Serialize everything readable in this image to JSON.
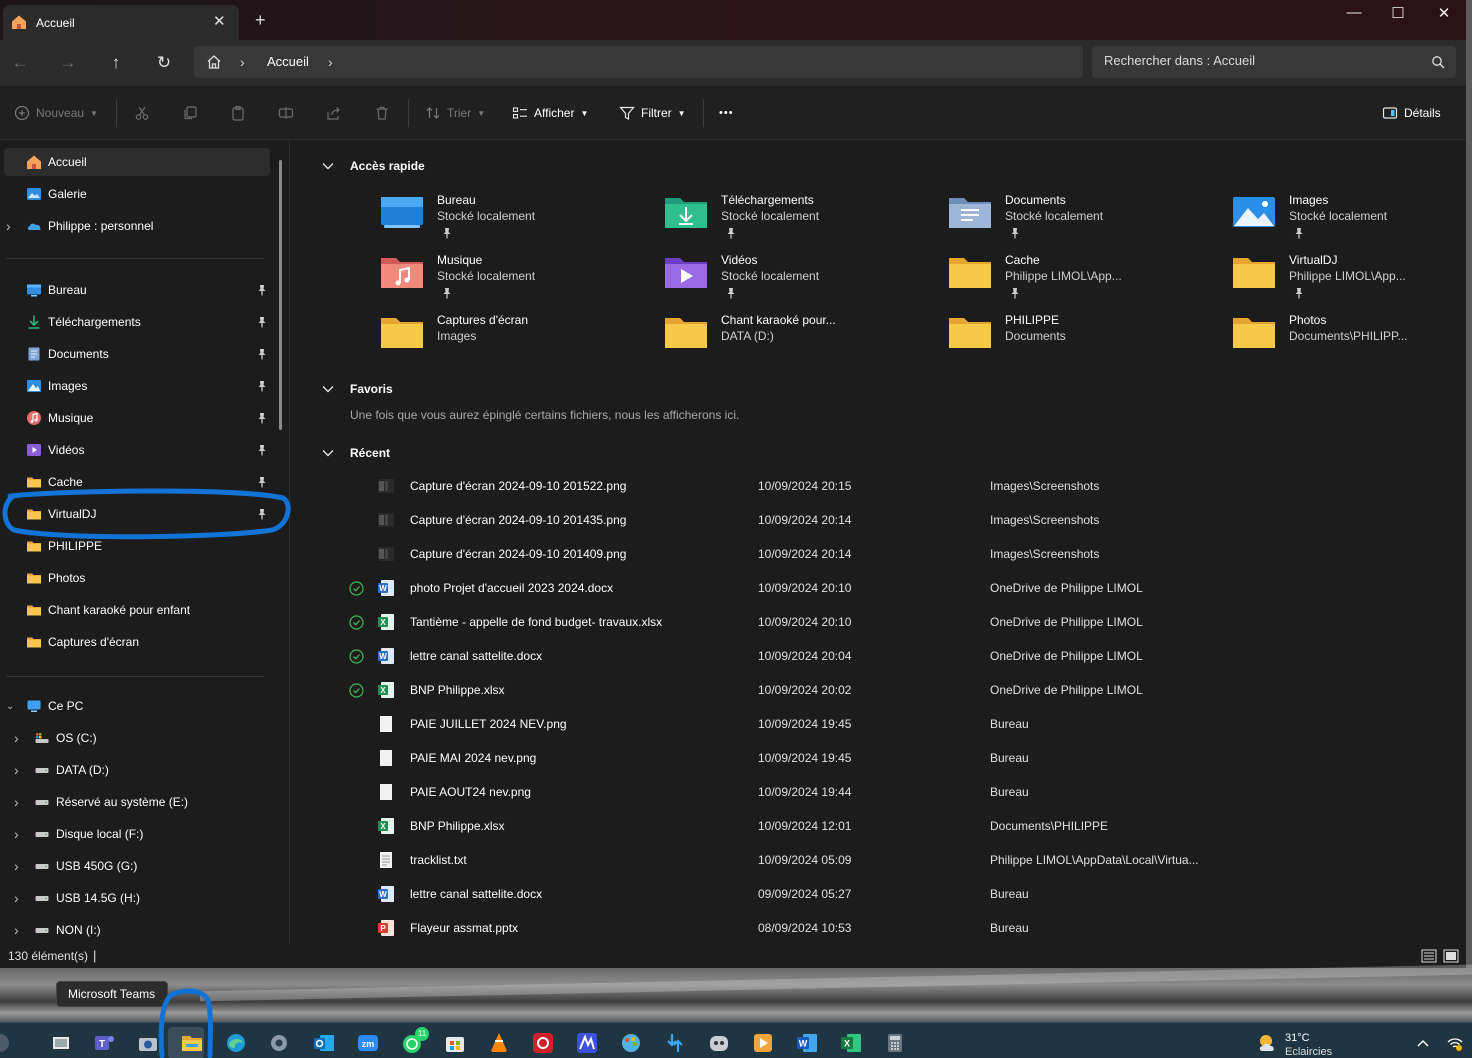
{
  "window": {
    "tab_title": "Accueil",
    "new_tab": "+",
    "controls": {
      "minimize": "—",
      "maximize": "☐",
      "close": "✕"
    }
  },
  "address": {
    "breadcrumb_current": "Accueil",
    "search_placeholder": "Rechercher dans : Accueil"
  },
  "toolbar": {
    "new_label": "Nouveau",
    "sort_label": "Trier",
    "view_label": "Afficher",
    "filter_label": "Filtrer",
    "more_label": "•••",
    "details_label": "Détails"
  },
  "sidebar": {
    "top": [
      {
        "label": "Accueil",
        "icon": "home-icon",
        "selected": true
      },
      {
        "label": "Galerie",
        "icon": "gallery-icon"
      },
      {
        "label": "Philippe : personnel",
        "icon": "onedrive-icon",
        "expandable": true
      }
    ],
    "pinned": [
      {
        "label": "Bureau",
        "icon": "desktop-folder-icon"
      },
      {
        "label": "Téléchargements",
        "icon": "download-icon"
      },
      {
        "label": "Documents",
        "icon": "documents-icon"
      },
      {
        "label": "Images",
        "icon": "pictures-icon"
      },
      {
        "label": "Musique",
        "icon": "music-icon"
      },
      {
        "label": "Vidéos",
        "icon": "videos-icon"
      },
      {
        "label": "Cache",
        "icon": "folder-icon"
      },
      {
        "label": "VirtualDJ",
        "icon": "folder-icon"
      }
    ],
    "folders": [
      {
        "label": "PHILIPPE"
      },
      {
        "label": "Photos"
      },
      {
        "label": "Chant karaoké pour enfant"
      },
      {
        "label": "Captures d'écran"
      }
    ],
    "this_pc": "Ce PC",
    "drives": [
      {
        "label": "OS (C:)"
      },
      {
        "label": "DATA (D:)"
      },
      {
        "label": "Réservé au système (E:)"
      },
      {
        "label": "Disque local (F:)"
      },
      {
        "label": "USB 450G (G:)"
      },
      {
        "label": "USB 14.5G (H:)"
      },
      {
        "label": "NON (I:)"
      }
    ]
  },
  "quick_access": {
    "title": "Accès rapide",
    "items": [
      {
        "name": "Bureau",
        "sub": "Stocké localement",
        "pinned": true,
        "icon": "desktop-folder-icon"
      },
      {
        "name": "Téléchargements",
        "sub": "Stocké localement",
        "pinned": true,
        "icon": "download-folder-icon"
      },
      {
        "name": "Documents",
        "sub": "Stocké localement",
        "pinned": true,
        "icon": "documents-folder-icon"
      },
      {
        "name": "Images",
        "sub": "Stocké localement",
        "pinned": true,
        "icon": "pictures-folder-icon"
      },
      {
        "name": "Musique",
        "sub": "Stocké localement",
        "pinned": true,
        "icon": "music-folder-icon"
      },
      {
        "name": "Vidéos",
        "sub": "Stocké localement",
        "pinned": true,
        "icon": "videos-folder-icon"
      },
      {
        "name": "Cache",
        "sub": "Philippe LIMOL\\App...",
        "pinned": true,
        "icon": "folder-icon"
      },
      {
        "name": "VirtualDJ",
        "sub": "Philippe LIMOL\\App...",
        "pinned": true,
        "icon": "folder-icon"
      },
      {
        "name": "Captures d'écran",
        "sub": "Images",
        "pinned": false,
        "icon": "folder-icon"
      },
      {
        "name": "Chant karaoké pour...",
        "sub": "DATA (D:)",
        "pinned": false,
        "icon": "folder-icon"
      },
      {
        "name": "PHILIPPE",
        "sub": "Documents",
        "pinned": false,
        "icon": "folder-icon"
      },
      {
        "name": "Photos",
        "sub": "Documents\\PHILIPP...",
        "pinned": false,
        "icon": "folder-icon"
      }
    ]
  },
  "favorites": {
    "title": "Favoris",
    "empty_text": "Une fois que vous aurez épinglé certains fichiers, nous les afficherons ici."
  },
  "recent": {
    "title": "Récent",
    "files": [
      {
        "name": "Capture d'écran 2024-09-10 201522.png",
        "date": "10/09/2024 20:15",
        "location": "Images\\Screenshots",
        "type": "image",
        "synced": false
      },
      {
        "name": "Capture d'écran 2024-09-10 201435.png",
        "date": "10/09/2024 20:14",
        "location": "Images\\Screenshots",
        "type": "image",
        "synced": false
      },
      {
        "name": "Capture d'écran 2024-09-10 201409.png",
        "date": "10/09/2024 20:14",
        "location": "Images\\Screenshots",
        "type": "image",
        "synced": false
      },
      {
        "name": "photo Projet d'accueil 2023  2024.docx",
        "date": "10/09/2024 20:10",
        "location": "OneDrive de Philippe LIMOL",
        "type": "word",
        "synced": true
      },
      {
        "name": "Tantième - appelle de fond budget- travaux.xlsx",
        "date": "10/09/2024 20:10",
        "location": "OneDrive de Philippe LIMOL",
        "type": "excel",
        "synced": true
      },
      {
        "name": "lettre canal sattelite.docx",
        "date": "10/09/2024 20:04",
        "location": "OneDrive de Philippe LIMOL",
        "type": "word",
        "synced": true
      },
      {
        "name": "BNP Philippe.xlsx",
        "date": "10/09/2024 20:02",
        "location": "OneDrive de Philippe LIMOL",
        "type": "excel",
        "synced": true
      },
      {
        "name": "PAIE JUILLET 2024 NEV.png",
        "date": "10/09/2024 19:45",
        "location": "Bureau",
        "type": "blank",
        "synced": false
      },
      {
        "name": "PAIE MAI 2024 nev.png",
        "date": "10/09/2024 19:45",
        "location": "Bureau",
        "type": "blank",
        "synced": false
      },
      {
        "name": "PAIE AOUT24 nev.png",
        "date": "10/09/2024 19:44",
        "location": "Bureau",
        "type": "blank",
        "synced": false
      },
      {
        "name": "BNP Philippe.xlsx",
        "date": "10/09/2024 12:01",
        "location": "Documents\\PHILIPPE",
        "type": "excel",
        "synced": false
      },
      {
        "name": "tracklist.txt",
        "date": "10/09/2024 05:09",
        "location": "Philippe LIMOL\\AppData\\Local\\Virtua...",
        "type": "text",
        "synced": false
      },
      {
        "name": "lettre canal sattelite.docx",
        "date": "09/09/2024 05:27",
        "location": "Bureau",
        "type": "word",
        "synced": false
      },
      {
        "name": "Flayeur assmat.pptx",
        "date": "08/09/2024 10:53",
        "location": "Bureau",
        "type": "powerpoint",
        "synced": false
      }
    ]
  },
  "status": {
    "count": "130 élément(s)",
    "separator": "|"
  },
  "tooltip": "Microsoft Teams",
  "taskbar": {
    "weather_temp": "31°C",
    "weather_desc": "Eclaircies",
    "whatsapp_badge": "11",
    "apps": [
      "windows-icon",
      "task-view-icon",
      "teams-icon",
      "camera-icon",
      "file-explorer-icon",
      "edge-icon",
      "settings-icon",
      "outlook-icon",
      "zoom-icon",
      "whatsapp-icon",
      "store-icon",
      "vlc-icon",
      "app-red-icon",
      "app-blue-icon",
      "paint-icon",
      "arrow-app-icon",
      "discord-icon",
      "media-player-icon",
      "word-icon",
      "excel-icon",
      "calculator-icon"
    ]
  },
  "colors": {
    "accent": "#4cc2ff",
    "annotation_blue": "#1273d6",
    "folder_yellow": "#f6c74a",
    "synced_green": "#3fb950",
    "word_blue": "#2b6fd1",
    "excel_green": "#1f8f52",
    "ppt_red": "#d2462e"
  }
}
